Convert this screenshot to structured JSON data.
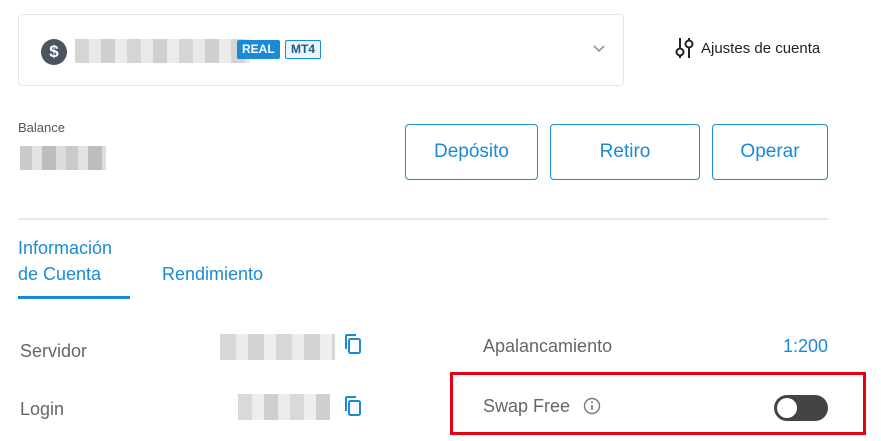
{
  "account": {
    "real_badge": "REAL",
    "platform_badge": "MT4",
    "currency_symbol": "$",
    "settings_label": "Ajustes de cuenta"
  },
  "balance": {
    "label": "Balance"
  },
  "actions": {
    "deposit_label": "Depósito",
    "withdraw_label": "Retiro",
    "trade_label": "Operar"
  },
  "tabs": [
    {
      "label": "Información de Cuenta",
      "active": true
    },
    {
      "label": "Rendimiento",
      "active": false
    }
  ],
  "info": {
    "server_label": "Servidor",
    "login_label": "Login",
    "leverage_label": "Apalancamiento",
    "leverage_value": "1:200",
    "swap_free_label": "Swap Free",
    "swap_free_enabled": false
  },
  "colors": {
    "accent": "#1a8ad6",
    "highlight": "#e3000f",
    "toggle_off": "#444444"
  },
  "icons": {
    "currency": "dollar-coin-icon",
    "dropdown": "chevron-down-icon",
    "settings": "sliders-icon",
    "copy": "copy-icon",
    "info": "info-icon"
  }
}
